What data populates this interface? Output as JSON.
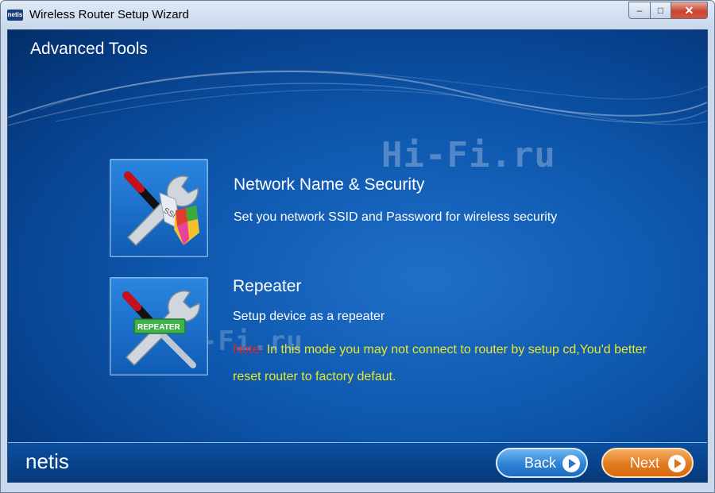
{
  "window": {
    "title": "Wireless Router Setup Wizard",
    "app_icon_text": "netis",
    "controls": {
      "minimize": "–",
      "maximize": "□",
      "close": "✕"
    }
  },
  "page": {
    "title": "Advanced Tools",
    "watermark_top": "Hi-Fi.ru",
    "watermark_mid": "Hi-Fi.ru"
  },
  "options": [
    {
      "icon": "wrench-screwdriver-ssid-shield-icon",
      "icon_text": "SSID",
      "title": "Network Name & Security",
      "description": "Set you network SSID and Password for wireless security"
    },
    {
      "icon": "wrench-screwdriver-repeater-icon",
      "icon_text": "REPEATER",
      "title": "Repeater",
      "description": "Setup device as a repeater",
      "note_label": "Note:",
      "note_text": " In this mode you may not connect to router by setup cd,You'd better reset router to factory defaut."
    }
  ],
  "footer": {
    "brand": "netis",
    "back_label": "Back",
    "next_label": "Next"
  },
  "colors": {
    "background": "#0d56ac",
    "note_label": "#e02525",
    "note_text": "#e8e82a",
    "back_button": "#2e82d6",
    "next_button": "#e27a1e"
  }
}
